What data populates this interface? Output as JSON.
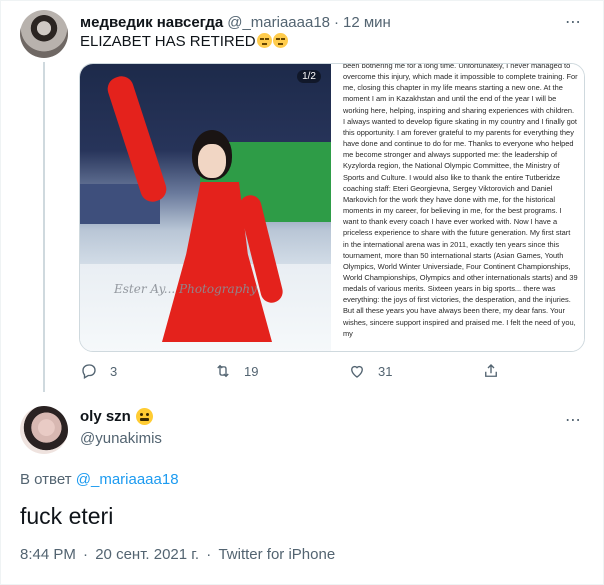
{
  "parent": {
    "display_name": "медведик навсегда",
    "handle": "@_mariaaaa18",
    "separator": "·",
    "time": "12 мин",
    "text": "ELIZABET HAS RETIRED",
    "text_emoji": "relieved-face-emoji",
    "media": {
      "photo_counter": "1/2",
      "watermark": "Ester Ay... Photography",
      "statement_text": "been bothering me for a long time. Unfortunately, I never managed to overcome this injury, which made it impossible to complete training. For me, closing this chapter in my life means starting a new one. At the moment I am in Kazakhstan and until the end of the year I will be working here, helping, inspiring and sharing experiences with children. I always wanted to develop figure skating in my country and I finally got this opportunity. I am forever grateful to my parents for everything they have done and continue to do for me. Thanks to everyone who helped me become stronger and always supported me: the leadership of Kyzylorda region, the National Olympic Committee, the Ministry of Sports and Culture. I would also like to thank the entire Tutberidze coaching staff: Eteri Georgievna, Sergey Viktorovich and Daniel Markovich for the work they have done with me, for the historical moments in my career, for believing in me, for the best programs. I want to thank every coach I have ever worked with. Now I have a priceless experience to share with the future generation. My first start in the international arena was in 2011, exactly ten years since this tournament, more than 50 international starts (Asian Games, Youth Olympics, World Winter Universiade, Four Continent Championships, World Championships, Olympics and other internationals starts) and 39 medals of various merits. Sixteen years in big sports... there was everything: the joys of first victories, the desperation, and the injuries. But all these years you have always been there, my dear fans. Your wishes, sincere support inspired and praised me. I felt the need of you, my"
    },
    "actions": {
      "reply_count": "3",
      "retweet_count": "19",
      "like_count": "31"
    }
  },
  "reply": {
    "display_name": "oly szn",
    "name_emoji": "grimacing-face-emoji",
    "handle": "@yunakimis",
    "reply_to_prefix": "В ответ",
    "reply_to_handle": "@_mariaaaa18",
    "text": "fuck eteri",
    "time": "8:44 PM",
    "date": "20 сент. 2021 г.",
    "source": "Twitter for iPhone",
    "separator": "·"
  },
  "colors": {
    "accent": "#1d9bf0",
    "secondary_text": "#536471",
    "primary_text": "#0f1419",
    "border": "#cfd9de"
  }
}
